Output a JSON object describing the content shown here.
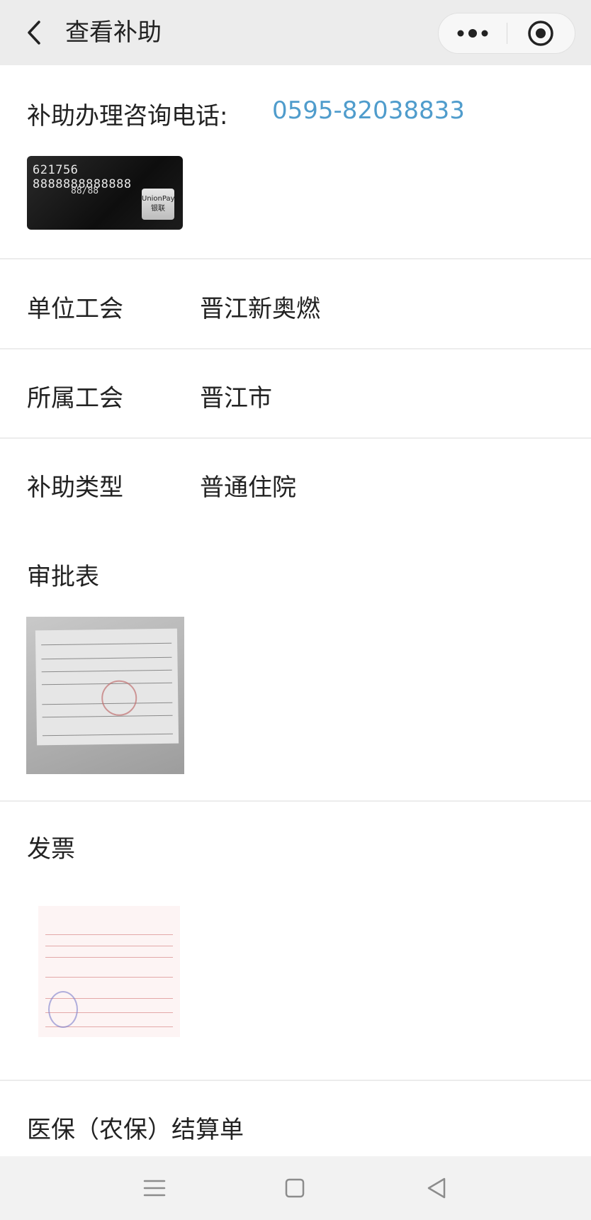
{
  "header": {
    "title": "查看补助"
  },
  "consult": {
    "label": "补助办理咨询电话:",
    "phone": "0595-82038833"
  },
  "bank_card": {
    "number": "621756 8888888888888",
    "valid_thru": "88/88",
    "brand": "UnionPay 银联"
  },
  "fields": [
    {
      "label": "单位工会",
      "value": "晋江新奥燃"
    },
    {
      "label": "所属工会",
      "value": "晋江市"
    },
    {
      "label": "补助类型",
      "value": "普通住院"
    }
  ],
  "sections": {
    "approval": "审批表",
    "invoice": "发票",
    "insurance": "医保（农保）结算单"
  },
  "icons": {
    "back": "chevron-left-icon",
    "more": "more-dots-icon",
    "close": "target-close-icon",
    "menu": "menu-lines-icon",
    "home": "square-home-icon",
    "nav_back": "triangle-back-icon"
  },
  "colors": {
    "phone_link": "#4f9ccc",
    "topbar": "#ececec"
  }
}
